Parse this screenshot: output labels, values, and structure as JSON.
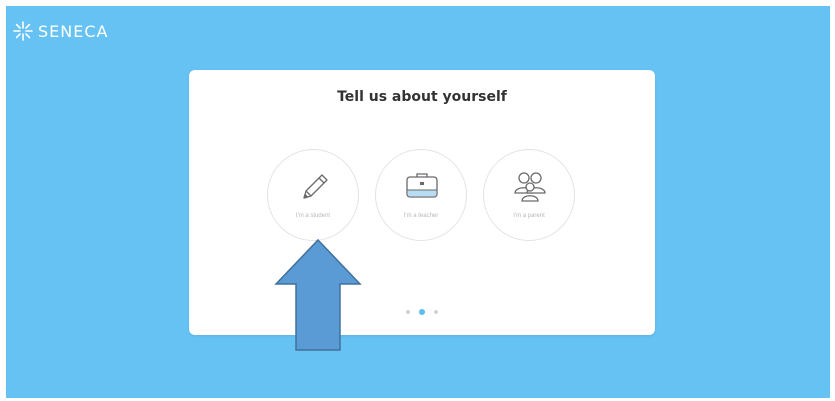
{
  "brand": {
    "name": "SENECA",
    "icon": "seneca-asterisk-logo"
  },
  "card": {
    "title": "Tell us about yourself",
    "options": [
      {
        "label": "I'm a student",
        "icon": "pencil-icon"
      },
      {
        "label": "I'm a teacher",
        "icon": "briefcase-icon"
      },
      {
        "label": "I'm a parent",
        "icon": "people-icon"
      }
    ],
    "pagination": {
      "total": 3,
      "active": 2
    }
  },
  "annotation": {
    "type": "up-arrow",
    "fill": "#5b9bd5",
    "stroke": "#41719c"
  },
  "colors": {
    "background": "#67c2f4",
    "card": "#ffffff",
    "accent": "#5bbdf0",
    "title_text": "#333333",
    "label_text": "#b8b8b8"
  }
}
